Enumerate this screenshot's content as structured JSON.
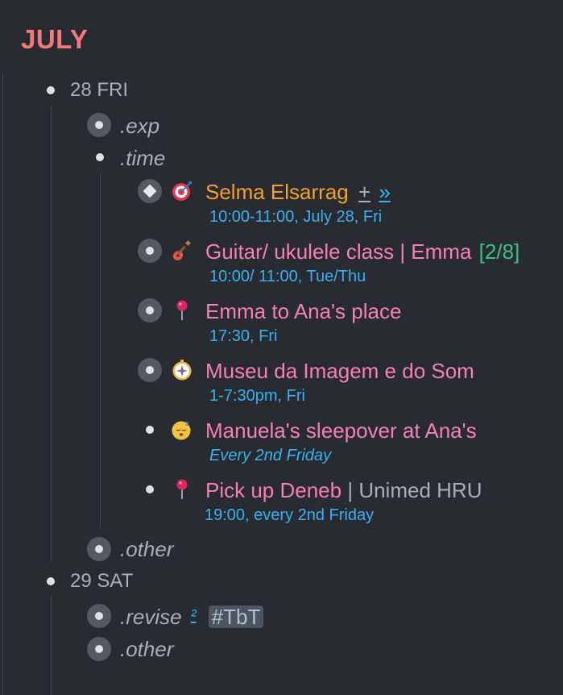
{
  "page": {
    "title": "JULY"
  },
  "days": [
    {
      "label": "28 FRI",
      "sections": {
        "exp": ".exp",
        "time": ".time",
        "other": ".other"
      },
      "events": [
        {
          "title": "Selma Elsarrag",
          "icon": "dart-target-icon",
          "plus_link": "+",
          "more_link": "»",
          "detail": "10:00-11:00, July 28, Fri"
        },
        {
          "title": "Guitar/ ukulele class | Emma",
          "progress": "[2/8]",
          "icon": "guitar-icon",
          "detail": "10:00/ 11:00, Tue/Thu"
        },
        {
          "title": "Emma to Ana's place",
          "icon": "round-pushpin-icon",
          "detail": "17:30, Fri"
        },
        {
          "title": "Museu da Imagem e do Som",
          "icon": "compass-icon",
          "detail": "1-7:30pm, Fri"
        },
        {
          "title": "Manuela's sleepover at Ana's",
          "icon": "sleeping-face-icon",
          "detail": "Every 2nd Friday"
        },
        {
          "title": "Pick up Deneb",
          "title_suffix": "| Unimed HRU",
          "icon": "round-pushpin-icon",
          "detail": "19:00, every 2nd Friday"
        }
      ]
    },
    {
      "label": "29 SAT",
      "sections": {
        "revise": ".revise",
        "revise_ref": "²",
        "revise_tag": "#TbT",
        "other": ".other"
      }
    }
  ],
  "colors": {
    "background": "#282c30",
    "title": "#f4797d",
    "event_pink": "#f77fb7",
    "event_orange": "#f2a12d",
    "detail_blue": "#3ab0f2",
    "progress_green": "#3dbf85"
  }
}
